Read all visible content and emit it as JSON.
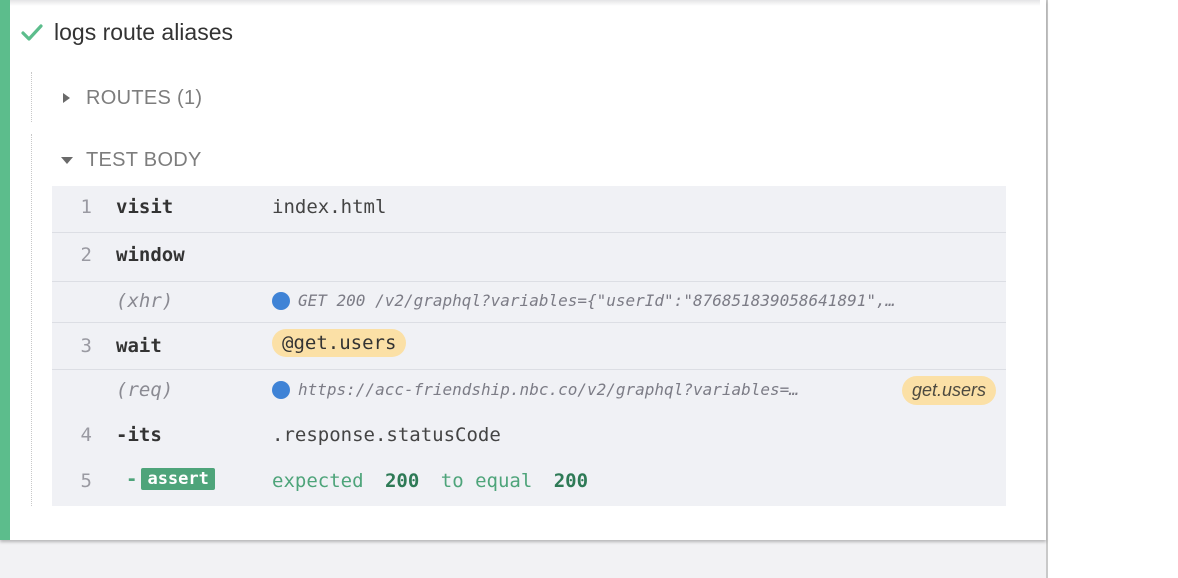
{
  "test": {
    "title": "logs route aliases",
    "status_icon": "check-icon",
    "accent_color": "#5cbd8c"
  },
  "sections": {
    "routes": {
      "label": "ROUTES (1)",
      "expanded": false
    },
    "test_body": {
      "label": "TEST BODY",
      "expanded": true
    }
  },
  "commands": [
    {
      "num": "1",
      "name": "visit",
      "message": "index.html"
    },
    {
      "num": "2",
      "name": "window",
      "message": ""
    },
    {
      "num": "",
      "name": "(xhr)",
      "message": "GET 200 /v2/graphql?variables={\"userId\":\"876851839058641891\",…"
    },
    {
      "num": "3",
      "name": "wait",
      "message": "@get.users"
    },
    {
      "num": "",
      "name": "(req)",
      "message": "https://acc-friendship.nbc.co/v2/graphql?variables=…",
      "alias": "get.users"
    },
    {
      "num": "4",
      "name": "-its",
      "message": ".response.statusCode"
    },
    {
      "num": "5",
      "name": "-",
      "badge": "assert",
      "message_parts": [
        "expected",
        "200",
        "to equal",
        "200"
      ]
    }
  ],
  "colors": {
    "pass": "#5cbd8c",
    "xhr_dot": "#3f83d6",
    "alias": "#fbe0a6",
    "assert": "#4ea47a"
  }
}
